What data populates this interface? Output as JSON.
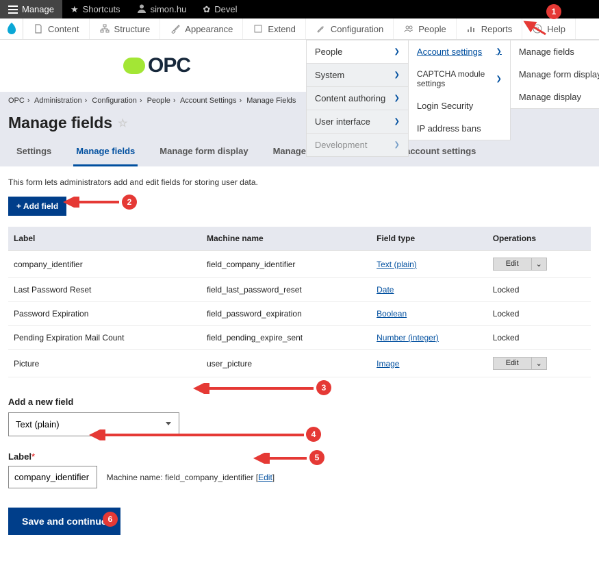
{
  "topbar": {
    "manage": "Manage",
    "shortcuts": "Shortcuts",
    "user": "simon.hu",
    "devel": "Devel"
  },
  "adminbar": {
    "content": "Content",
    "structure": "Structure",
    "appearance": "Appearance",
    "extend": "Extend",
    "configuration": "Configuration",
    "people": "People",
    "reports": "Reports",
    "help": "Help"
  },
  "submenu1": {
    "people": "People",
    "system": "System",
    "content_authoring": "Content authoring",
    "user_interface": "User interface",
    "development": "Development"
  },
  "submenu2": {
    "account_settings": "Account settings",
    "captcha": "CAPTCHA module settings",
    "login_security": "Login Security",
    "ip_bans": "IP address bans"
  },
  "submenu3": {
    "manage_fields": "Manage fields",
    "manage_form_display": "Manage form display",
    "manage_display": "Manage display"
  },
  "brand": "OPC",
  "breadcrumb": {
    "b1": "OPC",
    "b2": "Administration",
    "b3": "Configuration",
    "b4": "People",
    "b5": "Account Settings",
    "b6": "Manage Fields"
  },
  "page_title": "Manage fields",
  "tabs": {
    "settings": "Settings",
    "manage_fields": "Manage fields",
    "manage_form_display": "Manage form display",
    "manage_display": "Manage display",
    "translate": "Translate account settings"
  },
  "helptext": "This form lets administrators add and edit fields for storing user data.",
  "add_field_btn": "+ Add field",
  "table": {
    "headers": {
      "label": "Label",
      "machine": "Machine name",
      "type": "Field type",
      "ops": "Operations"
    },
    "rows": [
      {
        "label": "company_identifier",
        "machine": "field_company_identifier",
        "type": "Text (plain)",
        "op": "Edit"
      },
      {
        "label": "Last Password Reset",
        "machine": "field_last_password_reset",
        "type": "Date",
        "op": "Locked"
      },
      {
        "label": "Password Expiration",
        "machine": "field_password_expiration",
        "type": "Boolean",
        "op": "Locked"
      },
      {
        "label": "Pending Expiration Mail Count",
        "machine": "field_pending_expire_sent",
        "type": "Number (integer)",
        "op": "Locked"
      },
      {
        "label": "Picture",
        "machine": "user_picture",
        "type": "Image",
        "op": "Edit"
      }
    ]
  },
  "new_field": {
    "title": "Add a new field",
    "select_value": "Text (plain)",
    "label_label": "Label",
    "label_value": "company_identifier",
    "machine_prefix": "Machine name: ",
    "machine_value": "field_company_identifier",
    "edit": "Edit"
  },
  "save_btn": "Save and continue",
  "annotations": {
    "a1": "1",
    "a2": "2",
    "a3": "3",
    "a4": "4",
    "a5": "5",
    "a6": "6"
  }
}
